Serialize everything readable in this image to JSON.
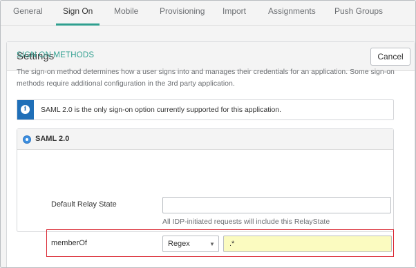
{
  "tabs": [
    {
      "label": "General",
      "active": false
    },
    {
      "label": "Sign On",
      "active": true
    },
    {
      "label": "Mobile",
      "active": false
    },
    {
      "label": "Provisioning",
      "active": false
    },
    {
      "label": "Import",
      "active": false
    },
    {
      "label": "Assignments",
      "active": false
    },
    {
      "label": "Push Groups",
      "active": false
    }
  ],
  "settings": {
    "title": "Settings",
    "cancel_label": "Cancel"
  },
  "sign_on_methods": {
    "title": "SIGN ON METHODS",
    "description": "The sign-on method determines how a user signs into and manages their credentials for an application. Some sign-on methods require additional configuration in the 3rd party application.",
    "info_text": "SAML 2.0 is the only sign-on option currently supported for this application.",
    "info_icon": "info-icon"
  },
  "saml": {
    "label": "SAML 2.0",
    "selected": true,
    "relay_state": {
      "label": "Default Relay State",
      "value": "",
      "hint": "All IDP-initiated requests will include this RelayState"
    },
    "member_of": {
      "label": "memberOf",
      "match_type": "Regex",
      "value": ".*"
    }
  },
  "colors": {
    "accent": "#2f9f8f",
    "info_blue": "#1f6fb8",
    "highlight_red": "#d9232e",
    "input_yellow": "#fbfbc0"
  }
}
